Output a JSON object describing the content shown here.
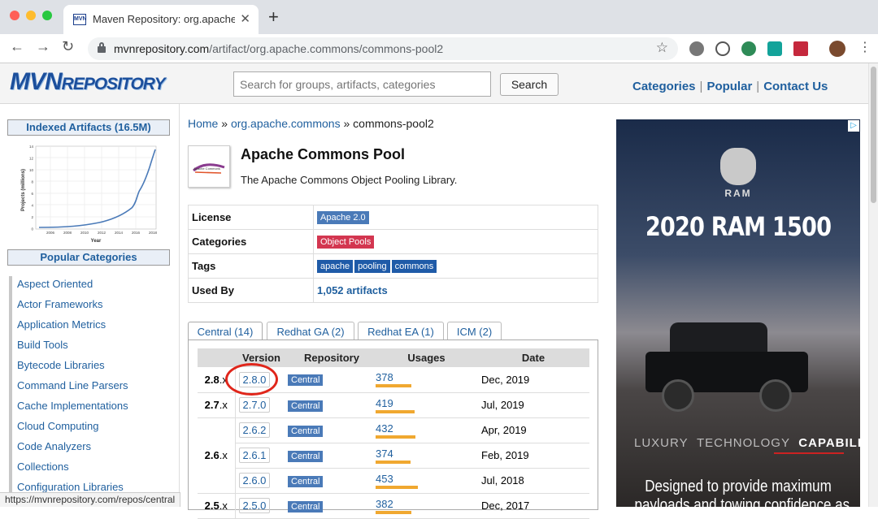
{
  "browser": {
    "tab_title": "Maven Repository: org.apache.c",
    "favicon_text": "MVN",
    "url_domain": "mvnrepository.com",
    "url_path": "/artifact/org.apache.commons/commons-pool2"
  },
  "header": {
    "logo_main": "MVN",
    "logo_sub": "REPOSITORY",
    "search_placeholder": "Search for groups, artifacts, categories",
    "search_button": "Search",
    "nav": [
      "Categories",
      "Popular",
      "Contact Us"
    ]
  },
  "sidebar": {
    "indexed_title": "Indexed Artifacts (16.5M)",
    "chart": {
      "ylabel": "Projects (millions)",
      "xlabel": "Year",
      "xticks": [
        "2006",
        "2008",
        "2010",
        "2012",
        "2014",
        "2016",
        "2018"
      ],
      "yticks": [
        "0",
        "2",
        "4",
        "6",
        "8",
        "10",
        "12",
        "14"
      ]
    },
    "popular_title": "Popular Categories",
    "categories": [
      "Aspect Oriented",
      "Actor Frameworks",
      "Application Metrics",
      "Build Tools",
      "Bytecode Libraries",
      "Command Line Parsers",
      "Cache Implementations",
      "Cloud Computing",
      "Code Analyzers",
      "Collections",
      "Configuration Libraries"
    ]
  },
  "main": {
    "breadcrumb": {
      "home": "Home",
      "sep": "»",
      "group": "org.apache.commons",
      "artifact": "commons-pool2"
    },
    "artifact_logo_text": "Apache Commons",
    "title": "Apache Commons Pool",
    "description": "The Apache Commons Object Pooling Library.",
    "info": {
      "license_label": "License",
      "license": "Apache 2.0",
      "categories_label": "Categories",
      "category": "Object Pools",
      "tags_label": "Tags",
      "tags": [
        "apache",
        "pooling",
        "commons"
      ],
      "usedby_label": "Used By",
      "usedby": "1,052 artifacts"
    },
    "tabs": [
      "Central (14)",
      "Redhat GA (2)",
      "Redhat EA (1)",
      "ICM (2)"
    ],
    "versions_table": {
      "headers": [
        "Version",
        "Repository",
        "Usages",
        "Date"
      ],
      "groups": [
        {
          "label": "2.8",
          "suffix": ".x"
        },
        {
          "label": "2.7",
          "suffix": ".x"
        },
        {
          "label": "2.6",
          "suffix": ".x"
        },
        {
          "label": "2.5",
          "suffix": ".x"
        }
      ],
      "rows": [
        {
          "version": "2.8.0",
          "repo": "Central",
          "usages": "378",
          "date": "Dec, 2019",
          "bar": 0.84
        },
        {
          "version": "2.7.0",
          "repo": "Central",
          "usages": "419",
          "date": "Jul, 2019",
          "bar": 0.93
        },
        {
          "version": "2.6.2",
          "repo": "Central",
          "usages": "432",
          "date": "Apr, 2019",
          "bar": 0.95
        },
        {
          "version": "2.6.1",
          "repo": "Central",
          "usages": "374",
          "date": "Feb, 2019",
          "bar": 0.83
        },
        {
          "version": "2.6.0",
          "repo": "Central",
          "usages": "453",
          "date": "Jul, 2018",
          "bar": 1.0
        },
        {
          "version": "2.5.0",
          "repo": "Central",
          "usages": "382",
          "date": "Dec, 2017",
          "bar": 0.85
        }
      ]
    }
  },
  "ad": {
    "info_icon": "▷",
    "brand": "RAM",
    "headline": "2020 RAM 1500",
    "tagline_1": "LUXURY",
    "tagline_2": "TECHNOLOGY",
    "tagline_3": "CAPABILITY",
    "footer_1": "Designed to provide maximum",
    "footer_2": "payloads and towing confidence as"
  },
  "status_bar": "https://mvnrepository.com/repos/central",
  "colors": {
    "link": "#1f5f9e",
    "license_badge": "#4a7ab8",
    "category_badge": "#d33650",
    "tag_badge": "#1f5ba8",
    "usage_bar": "#f0a830",
    "highlight_circle": "#e0261b"
  }
}
